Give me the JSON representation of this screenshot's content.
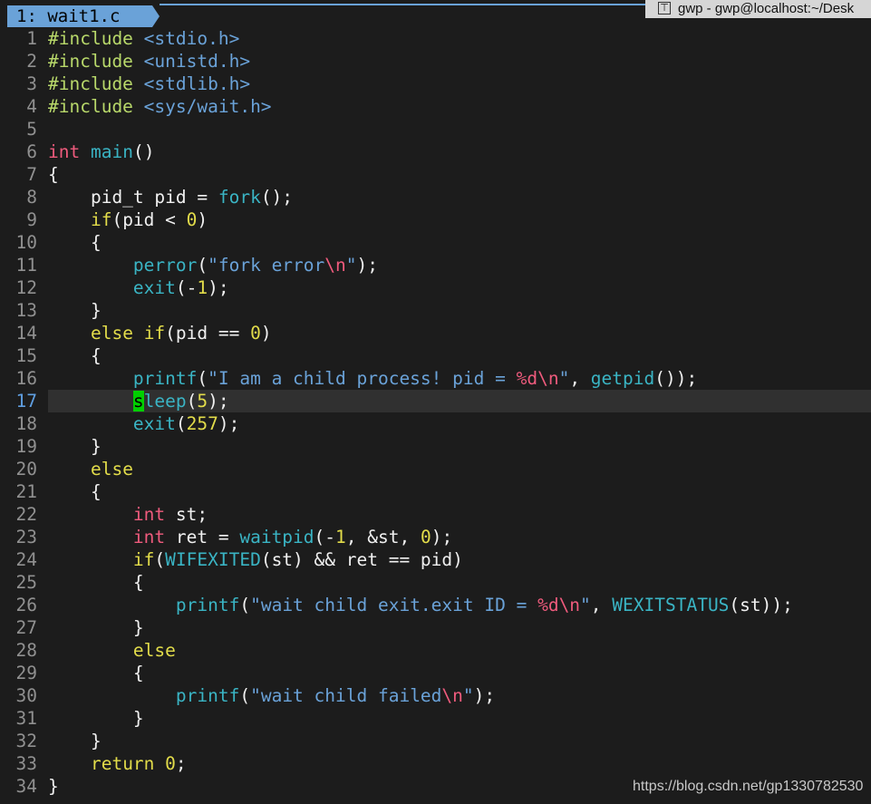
{
  "tab": {
    "label": "1: wait1.c"
  },
  "window": {
    "title": "gwp - gwp@localhost:~/Desk"
  },
  "editor": {
    "current_line": 17,
    "lines": [
      {
        "n": "1",
        "code": "#include <stdio.h>"
      },
      {
        "n": "2",
        "code": "#include <unistd.h>"
      },
      {
        "n": "3",
        "code": "#include <stdlib.h>"
      },
      {
        "n": "4",
        "code": "#include <sys/wait.h>"
      },
      {
        "n": "5",
        "code": ""
      },
      {
        "n": "6",
        "code": "int main()"
      },
      {
        "n": "7",
        "code": "{"
      },
      {
        "n": "8",
        "code": "    pid_t pid = fork();"
      },
      {
        "n": "9",
        "code": "    if(pid < 0)"
      },
      {
        "n": "10",
        "code": "    {"
      },
      {
        "n": "11",
        "code": "        perror(\"fork error\\n\");"
      },
      {
        "n": "12",
        "code": "        exit(-1);"
      },
      {
        "n": "13",
        "code": "    }"
      },
      {
        "n": "14",
        "code": "    else if(pid == 0)"
      },
      {
        "n": "15",
        "code": "    {"
      },
      {
        "n": "16",
        "code": "        printf(\"I am a child process! pid = %d\\n\", getpid());"
      },
      {
        "n": "17",
        "code": "        sleep(5);"
      },
      {
        "n": "18",
        "code": "        exit(257);"
      },
      {
        "n": "19",
        "code": "    }"
      },
      {
        "n": "20",
        "code": "    else"
      },
      {
        "n": "21",
        "code": "    {"
      },
      {
        "n": "22",
        "code": "        int st;"
      },
      {
        "n": "23",
        "code": "        int ret = waitpid(-1, &st, 0);"
      },
      {
        "n": "24",
        "code": "        if(WIFEXITED(st) && ret == pid)"
      },
      {
        "n": "25",
        "code": "        {"
      },
      {
        "n": "26",
        "code": "            printf(\"wait child exit.exit ID = %d\\n\", WEXITSTATUS(st));"
      },
      {
        "n": "27",
        "code": "        }"
      },
      {
        "n": "28",
        "code": "        else"
      },
      {
        "n": "29",
        "code": "        {"
      },
      {
        "n": "30",
        "code": "            printf(\"wait child failed\\n\");"
      },
      {
        "n": "31",
        "code": "        }"
      },
      {
        "n": "32",
        "code": "    }"
      },
      {
        "n": "33",
        "code": "    return 0;"
      },
      {
        "n": "34",
        "code": "}"
      }
    ]
  },
  "watermark": "https://blog.csdn.net/gp1330782530",
  "colors": {
    "background": "#1c1c1c",
    "tab": "#6aa2d8",
    "preprocessor": "#b8d86a",
    "type": "#ef5b7d",
    "function": "#3ab4c4",
    "keyword": "#e2dc4a",
    "string": "#6aa2d8",
    "cursor": "#00d000"
  }
}
